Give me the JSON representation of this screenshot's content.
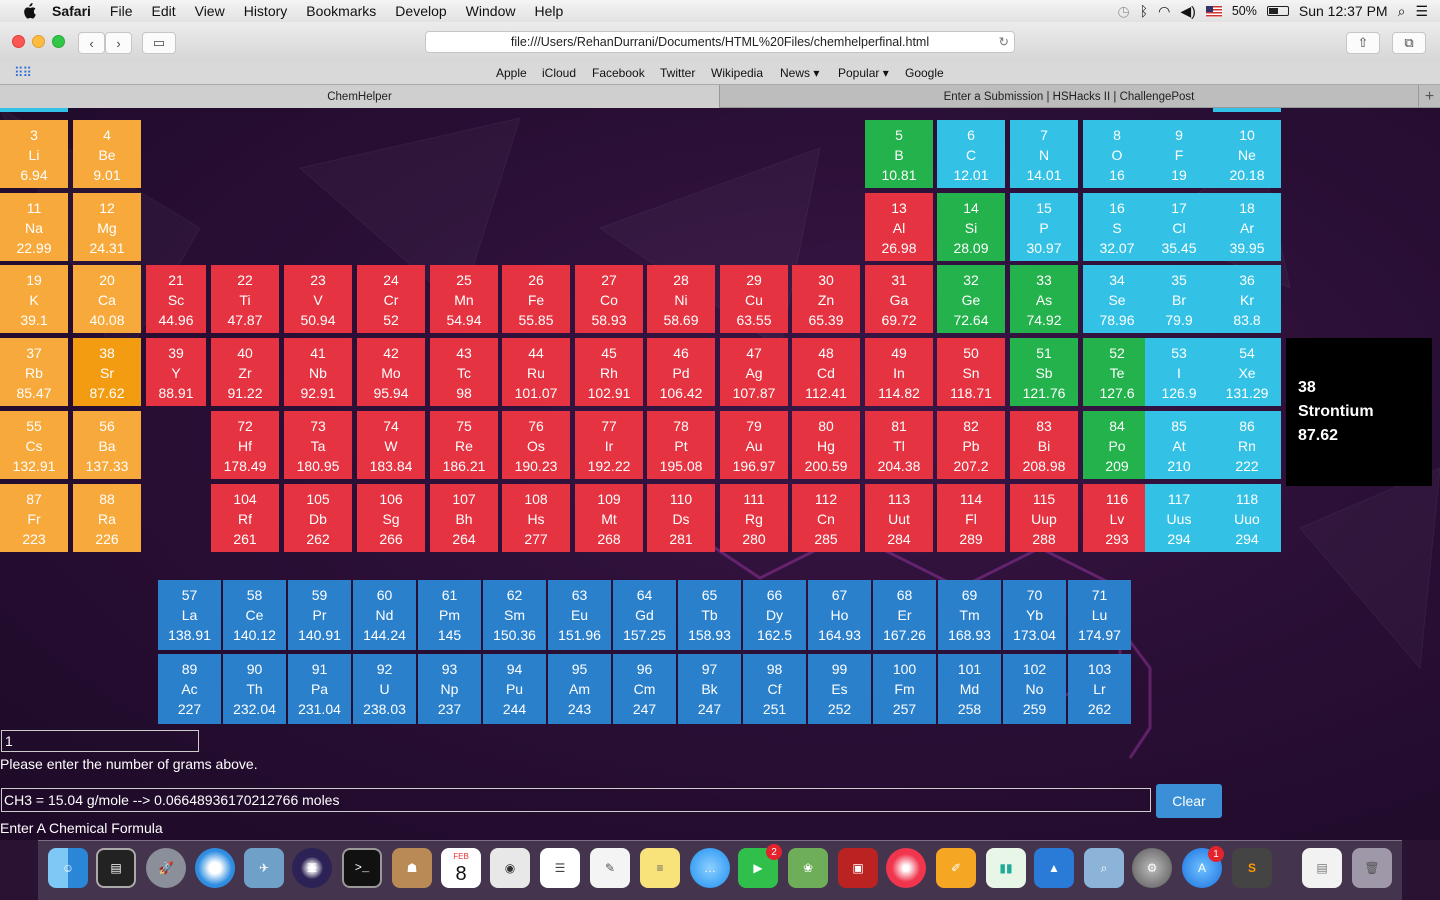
{
  "menubar": {
    "items": [
      "Safari",
      "File",
      "Edit",
      "View",
      "History",
      "Bookmarks",
      "Develop",
      "Window",
      "Help"
    ],
    "battery": "50%",
    "clock": "Sun 12:37 PM"
  },
  "toolbar": {
    "url": "file:///Users/RehanDurrani/Documents/HTML%20Files/chemhelperfinal.html"
  },
  "favorites": [
    "Apple",
    "iCloud",
    "Facebook",
    "Twitter",
    "Wikipedia",
    "News ▾",
    "Popular ▾",
    "Google"
  ],
  "tabs": [
    "ChemHelper",
    "Enter a Submission | HSHacks II | ChallengePost"
  ],
  "elements": [
    {
      "n": "3",
      "s": "Li",
      "m": "6.94",
      "c": "c-or"
    },
    {
      "n": "4",
      "s": "Be",
      "m": "9.01",
      "c": "c-or"
    },
    {
      "n": "5",
      "s": "B",
      "m": "10.81",
      "c": "c-green"
    },
    {
      "n": "6",
      "s": "C",
      "m": "12.01",
      "c": "c-cyan"
    },
    {
      "n": "7",
      "s": "N",
      "m": "14.01",
      "c": "c-cyan"
    },
    {
      "n": "8",
      "s": "O",
      "m": "16",
      "c": "c-cyan"
    },
    {
      "n": "9",
      "s": "F",
      "m": "19",
      "c": "c-cyan"
    },
    {
      "n": "10",
      "s": "Ne",
      "m": "20.18",
      "c": "c-cyan"
    },
    {
      "n": "11",
      "s": "Na",
      "m": "22.99",
      "c": "c-or"
    },
    {
      "n": "12",
      "s": "Mg",
      "m": "24.31",
      "c": "c-or"
    },
    {
      "n": "13",
      "s": "Al",
      "m": "26.98",
      "c": "c-red"
    },
    {
      "n": "14",
      "s": "Si",
      "m": "28.09",
      "c": "c-green"
    },
    {
      "n": "15",
      "s": "P",
      "m": "30.97",
      "c": "c-cyan"
    },
    {
      "n": "16",
      "s": "S",
      "m": "32.07",
      "c": "c-cyan"
    },
    {
      "n": "17",
      "s": "Cl",
      "m": "35.45",
      "c": "c-cyan"
    },
    {
      "n": "18",
      "s": "Ar",
      "m": "39.95",
      "c": "c-cyan"
    },
    {
      "n": "19",
      "s": "K",
      "m": "39.1",
      "c": "c-or"
    },
    {
      "n": "20",
      "s": "Ca",
      "m": "40.08",
      "c": "c-or"
    },
    {
      "n": "21",
      "s": "Sc",
      "m": "44.96",
      "c": "c-red"
    },
    {
      "n": "22",
      "s": "Ti",
      "m": "47.87",
      "c": "c-red"
    },
    {
      "n": "23",
      "s": "V",
      "m": "50.94",
      "c": "c-red"
    },
    {
      "n": "24",
      "s": "Cr",
      "m": "52",
      "c": "c-red"
    },
    {
      "n": "25",
      "s": "Mn",
      "m": "54.94",
      "c": "c-red"
    },
    {
      "n": "26",
      "s": "Fe",
      "m": "55.85",
      "c": "c-red"
    },
    {
      "n": "27",
      "s": "Co",
      "m": "58.93",
      "c": "c-red"
    },
    {
      "n": "28",
      "s": "Ni",
      "m": "58.69",
      "c": "c-red"
    },
    {
      "n": "29",
      "s": "Cu",
      "m": "63.55",
      "c": "c-red"
    },
    {
      "n": "30",
      "s": "Zn",
      "m": "65.39",
      "c": "c-red"
    },
    {
      "n": "31",
      "s": "Ga",
      "m": "69.72",
      "c": "c-red"
    },
    {
      "n": "32",
      "s": "Ge",
      "m": "72.64",
      "c": "c-green"
    },
    {
      "n": "33",
      "s": "As",
      "m": "74.92",
      "c": "c-green"
    },
    {
      "n": "34",
      "s": "Se",
      "m": "78.96",
      "c": "c-cyan"
    },
    {
      "n": "35",
      "s": "Br",
      "m": "79.9",
      "c": "c-cyan"
    },
    {
      "n": "36",
      "s": "Kr",
      "m": "83.8",
      "c": "c-cyan"
    },
    {
      "n": "37",
      "s": "Rb",
      "m": "85.47",
      "c": "c-or"
    },
    {
      "n": "38",
      "s": "Sr",
      "m": "87.62",
      "c": "c-or2"
    },
    {
      "n": "39",
      "s": "Y",
      "m": "88.91",
      "c": "c-red"
    },
    {
      "n": "40",
      "s": "Zr",
      "m": "91.22",
      "c": "c-red"
    },
    {
      "n": "41",
      "s": "Nb",
      "m": "92.91",
      "c": "c-red"
    },
    {
      "n": "42",
      "s": "Mo",
      "m": "95.94",
      "c": "c-red"
    },
    {
      "n": "43",
      "s": "Tc",
      "m": "98",
      "c": "c-red"
    },
    {
      "n": "44",
      "s": "Ru",
      "m": "101.07",
      "c": "c-red"
    },
    {
      "n": "45",
      "s": "Rh",
      "m": "102.91",
      "c": "c-red"
    },
    {
      "n": "46",
      "s": "Pd",
      "m": "106.42",
      "c": "c-red"
    },
    {
      "n": "47",
      "s": "Ag",
      "m": "107.87",
      "c": "c-red"
    },
    {
      "n": "48",
      "s": "Cd",
      "m": "112.41",
      "c": "c-red"
    },
    {
      "n": "49",
      "s": "In",
      "m": "114.82",
      "c": "c-red"
    },
    {
      "n": "50",
      "s": "Sn",
      "m": "118.71",
      "c": "c-red"
    },
    {
      "n": "51",
      "s": "Sb",
      "m": "121.76",
      "c": "c-green"
    },
    {
      "n": "52",
      "s": "Te",
      "m": "127.6",
      "c": "c-green"
    },
    {
      "n": "53",
      "s": "I",
      "m": "126.9",
      "c": "c-cyan"
    },
    {
      "n": "54",
      "s": "Xe",
      "m": "131.29",
      "c": "c-cyan"
    },
    {
      "n": "55",
      "s": "Cs",
      "m": "132.91",
      "c": "c-or"
    },
    {
      "n": "56",
      "s": "Ba",
      "m": "137.33",
      "c": "c-or"
    },
    {
      "n": "72",
      "s": "Hf",
      "m": "178.49",
      "c": "c-red"
    },
    {
      "n": "73",
      "s": "Ta",
      "m": "180.95",
      "c": "c-red"
    },
    {
      "n": "74",
      "s": "W",
      "m": "183.84",
      "c": "c-red"
    },
    {
      "n": "75",
      "s": "Re",
      "m": "186.21",
      "c": "c-red"
    },
    {
      "n": "76",
      "s": "Os",
      "m": "190.23",
      "c": "c-red"
    },
    {
      "n": "77",
      "s": "Ir",
      "m": "192.22",
      "c": "c-red"
    },
    {
      "n": "78",
      "s": "Pt",
      "m": "195.08",
      "c": "c-red"
    },
    {
      "n": "79",
      "s": "Au",
      "m": "196.97",
      "c": "c-red"
    },
    {
      "n": "80",
      "s": "Hg",
      "m": "200.59",
      "c": "c-red"
    },
    {
      "n": "81",
      "s": "Tl",
      "m": "204.38",
      "c": "c-red"
    },
    {
      "n": "82",
      "s": "Pb",
      "m": "207.2",
      "c": "c-red"
    },
    {
      "n": "83",
      "s": "Bi",
      "m": "208.98",
      "c": "c-red"
    },
    {
      "n": "84",
      "s": "Po",
      "m": "209",
      "c": "c-green"
    },
    {
      "n": "85",
      "s": "At",
      "m": "210",
      "c": "c-cyan"
    },
    {
      "n": "86",
      "s": "Rn",
      "m": "222",
      "c": "c-cyan"
    },
    {
      "n": "87",
      "s": "Fr",
      "m": "223",
      "c": "c-or"
    },
    {
      "n": "88",
      "s": "Ra",
      "m": "226",
      "c": "c-or"
    },
    {
      "n": "104",
      "s": "Rf",
      "m": "261",
      "c": "c-red"
    },
    {
      "n": "105",
      "s": "Db",
      "m": "262",
      "c": "c-red"
    },
    {
      "n": "106",
      "s": "Sg",
      "m": "266",
      "c": "c-red"
    },
    {
      "n": "107",
      "s": "Bh",
      "m": "264",
      "c": "c-red"
    },
    {
      "n": "108",
      "s": "Hs",
      "m": "277",
      "c": "c-red"
    },
    {
      "n": "109",
      "s": "Mt",
      "m": "268",
      "c": "c-red"
    },
    {
      "n": "110",
      "s": "Ds",
      "m": "281",
      "c": "c-red"
    },
    {
      "n": "111",
      "s": "Rg",
      "m": "280",
      "c": "c-red"
    },
    {
      "n": "112",
      "s": "Cn",
      "m": "285",
      "c": "c-red"
    },
    {
      "n": "113",
      "s": "Uut",
      "m": "284",
      "c": "c-red"
    },
    {
      "n": "114",
      "s": "Fl",
      "m": "289",
      "c": "c-red"
    },
    {
      "n": "115",
      "s": "Uup",
      "m": "288",
      "c": "c-red"
    },
    {
      "n": "116",
      "s": "Lv",
      "m": "293",
      "c": "c-red"
    },
    {
      "n": "117",
      "s": "Uus",
      "m": "294",
      "c": "c-cyan"
    },
    {
      "n": "118",
      "s": "Uuo",
      "m": "294",
      "c": "c-cyan"
    },
    {
      "n": "57",
      "s": "La",
      "m": "138.91",
      "c": "c-blue"
    },
    {
      "n": "58",
      "s": "Ce",
      "m": "140.12",
      "c": "c-blue"
    },
    {
      "n": "59",
      "s": "Pr",
      "m": "140.91",
      "c": "c-blue"
    },
    {
      "n": "60",
      "s": "Nd",
      "m": "144.24",
      "c": "c-blue"
    },
    {
      "n": "61",
      "s": "Pm",
      "m": "145",
      "c": "c-blue"
    },
    {
      "n": "62",
      "s": "Sm",
      "m": "150.36",
      "c": "c-blue"
    },
    {
      "n": "63",
      "s": "Eu",
      "m": "151.96",
      "c": "c-blue"
    },
    {
      "n": "64",
      "s": "Gd",
      "m": "157.25",
      "c": "c-blue"
    },
    {
      "n": "65",
      "s": "Tb",
      "m": "158.93",
      "c": "c-blue"
    },
    {
      "n": "66",
      "s": "Dy",
      "m": "162.5",
      "c": "c-blue"
    },
    {
      "n": "67",
      "s": "Ho",
      "m": "164.93",
      "c": "c-blue"
    },
    {
      "n": "68",
      "s": "Er",
      "m": "167.26",
      "c": "c-blue"
    },
    {
      "n": "69",
      "s": "Tm",
      "m": "168.93",
      "c": "c-blue"
    },
    {
      "n": "70",
      "s": "Yb",
      "m": "173.04",
      "c": "c-blue"
    },
    {
      "n": "71",
      "s": "Lu",
      "m": "174.97",
      "c": "c-blue"
    },
    {
      "n": "89",
      "s": "Ac",
      "m": "227",
      "c": "c-blue"
    },
    {
      "n": "90",
      "s": "Th",
      "m": "232.04",
      "c": "c-blue"
    },
    {
      "n": "91",
      "s": "Pa",
      "m": "231.04",
      "c": "c-blue"
    },
    {
      "n": "92",
      "s": "U",
      "m": "238.03",
      "c": "c-blue"
    },
    {
      "n": "93",
      "s": "Np",
      "m": "237",
      "c": "c-blue"
    },
    {
      "n": "94",
      "s": "Pu",
      "m": "244",
      "c": "c-blue"
    },
    {
      "n": "95",
      "s": "Am",
      "m": "243",
      "c": "c-blue"
    },
    {
      "n": "96",
      "s": "Cm",
      "m": "247",
      "c": "c-blue"
    },
    {
      "n": "97",
      "s": "Bk",
      "m": "247",
      "c": "c-blue"
    },
    {
      "n": "98",
      "s": "Cf",
      "m": "251",
      "c": "c-blue"
    },
    {
      "n": "99",
      "s": "Es",
      "m": "252",
      "c": "c-blue"
    },
    {
      "n": "100",
      "s": "Fm",
      "m": "257",
      "c": "c-blue"
    },
    {
      "n": "101",
      "s": "Md",
      "m": "258",
      "c": "c-blue"
    },
    {
      "n": "102",
      "s": "No",
      "m": "259",
      "c": "c-blue"
    },
    {
      "n": "103",
      "s": "Lr",
      "m": "262",
      "c": "c-blue"
    }
  ],
  "info": {
    "number": "38",
    "name": "Strontium",
    "mass": "87.62"
  },
  "form": {
    "grams_value": "1",
    "grams_label": "Please enter the number of grams above.",
    "formula_value": "CH3 = 15.04 g/mole --> 0.06648936170212766 moles",
    "formula_label": "Enter A Chemical Formula",
    "clear_label": "Clear"
  },
  "dock": {
    "calendar_month": "FEB",
    "calendar_day": "8",
    "facetime_badge": "2",
    "appstore_badge": "1"
  },
  "colors": {
    "orange": "#f7a93b",
    "red": "#e53341",
    "green": "#23b24b",
    "cyan": "#33c2e6",
    "blue": "#2b80cc"
  }
}
